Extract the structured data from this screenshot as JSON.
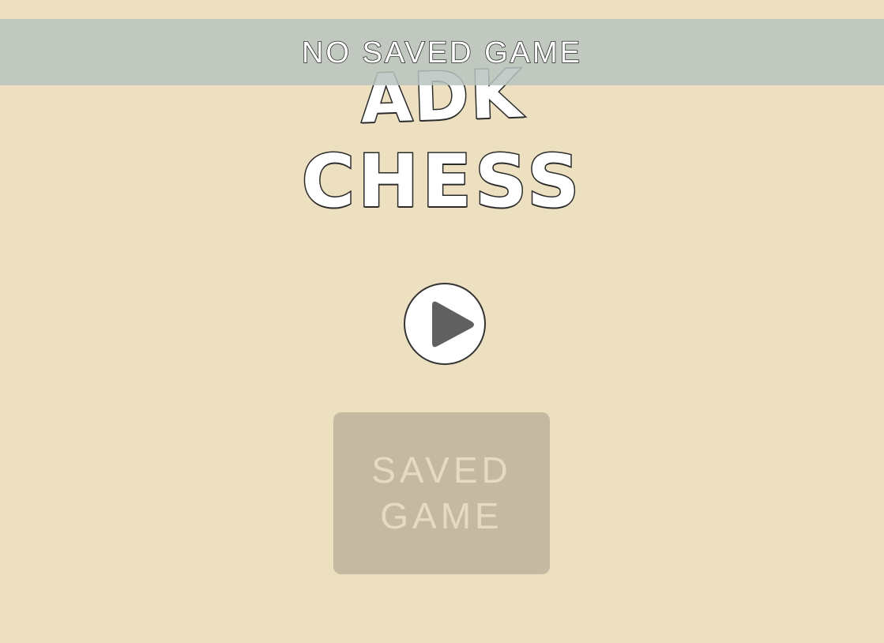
{
  "title": {
    "line1": "ADK",
    "line2": "CHESS"
  },
  "toast": {
    "message": "NO SAVED GAME"
  },
  "play_button": {
    "icon": "play-icon"
  },
  "saved_game_button": {
    "line1": "SAVED",
    "line2": "GAME",
    "state": "disabled"
  },
  "colors": {
    "background": "#ede0c0",
    "toast_bg": "#b9c3be",
    "saved_button_bg": "#c6b9a2",
    "play_icon": "#606060"
  }
}
